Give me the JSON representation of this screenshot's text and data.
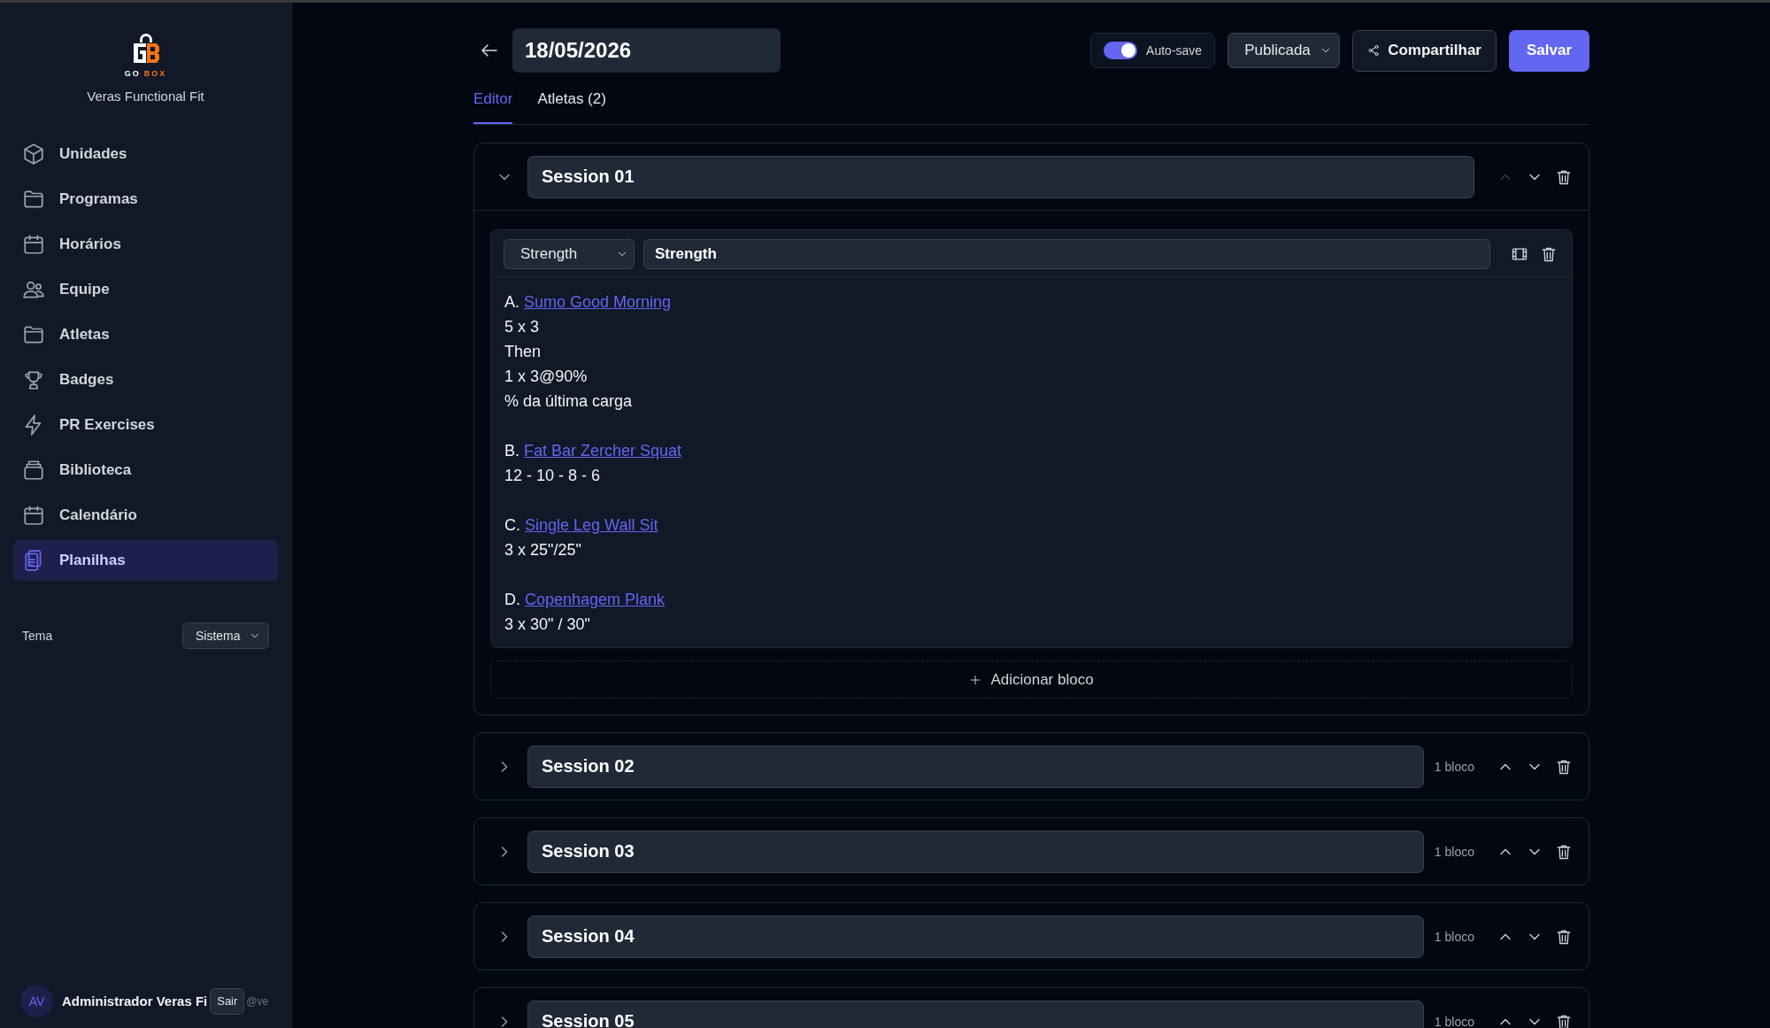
{
  "sidebar": {
    "logo": {
      "left": "GO",
      "right": "BOX"
    },
    "org": "Veras Functional Fit",
    "items": [
      {
        "label": "Unidades",
        "selected": false
      },
      {
        "label": "Programas",
        "selected": false
      },
      {
        "label": "Horários",
        "selected": false
      },
      {
        "label": "Equipe",
        "selected": false
      },
      {
        "label": "Atletas",
        "selected": false
      },
      {
        "label": "Badges",
        "selected": false
      },
      {
        "label": "PR Exercises",
        "selected": false
      },
      {
        "label": "Biblioteca",
        "selected": false
      },
      {
        "label": "Calendário",
        "selected": false
      },
      {
        "label": "Planilhas",
        "selected": true
      }
    ],
    "theme": {
      "label": "Tema",
      "value": "Sistema"
    },
    "user": {
      "initials": "AV",
      "name": "Administrador Veras Fi",
      "logout": "Sair",
      "handle": "@ve"
    }
  },
  "header": {
    "date": "18/05/2026",
    "autosave": {
      "label": "Auto-save",
      "on": true
    },
    "status": "Publicada",
    "share": "Compartilhar",
    "save": "Salvar"
  },
  "tabs": [
    {
      "label": "Editor",
      "selected": true
    },
    {
      "label": "Atletas (2)",
      "selected": false
    }
  ],
  "sessions": [
    {
      "title": "Session 01",
      "expanded": true,
      "up_disabled": true,
      "blocks": [
        {
          "type": "Strength",
          "title": "Strength",
          "lines": [
            {
              "kind": "exercise",
              "prefix": "A.",
              "link": "Sumo Good Morning"
            },
            {
              "kind": "text",
              "text": "5 x 3"
            },
            {
              "kind": "text",
              "text": "Then"
            },
            {
              "kind": "text",
              "text": "1 x 3@90%"
            },
            {
              "kind": "text",
              "text": "% da última carga"
            },
            {
              "kind": "blank"
            },
            {
              "kind": "exercise",
              "prefix": "B.",
              "link": "Fat Bar Zercher Squat"
            },
            {
              "kind": "text",
              "text": "12 - 10 - 8 - 6"
            },
            {
              "kind": "blank"
            },
            {
              "kind": "exercise",
              "prefix": "C.",
              "link": "Single Leg Wall Sit"
            },
            {
              "kind": "text",
              "text": "3 x 25\"/25\""
            },
            {
              "kind": "blank"
            },
            {
              "kind": "exercise",
              "prefix": "D.",
              "link": "Copenhagem Plank"
            },
            {
              "kind": "text",
              "text": "3 x 30\" / 30\""
            }
          ]
        }
      ],
      "add_block": "Adicionar bloco"
    },
    {
      "title": "Session 02",
      "expanded": false,
      "up_disabled": false,
      "count": "1 bloco"
    },
    {
      "title": "Session 03",
      "expanded": false,
      "up_disabled": false,
      "count": "1 bloco"
    },
    {
      "title": "Session 04",
      "expanded": false,
      "up_disabled": false,
      "count": "1 bloco"
    },
    {
      "title": "Session 05",
      "expanded": false,
      "up_disabled": false,
      "count": "1 bloco"
    }
  ]
}
